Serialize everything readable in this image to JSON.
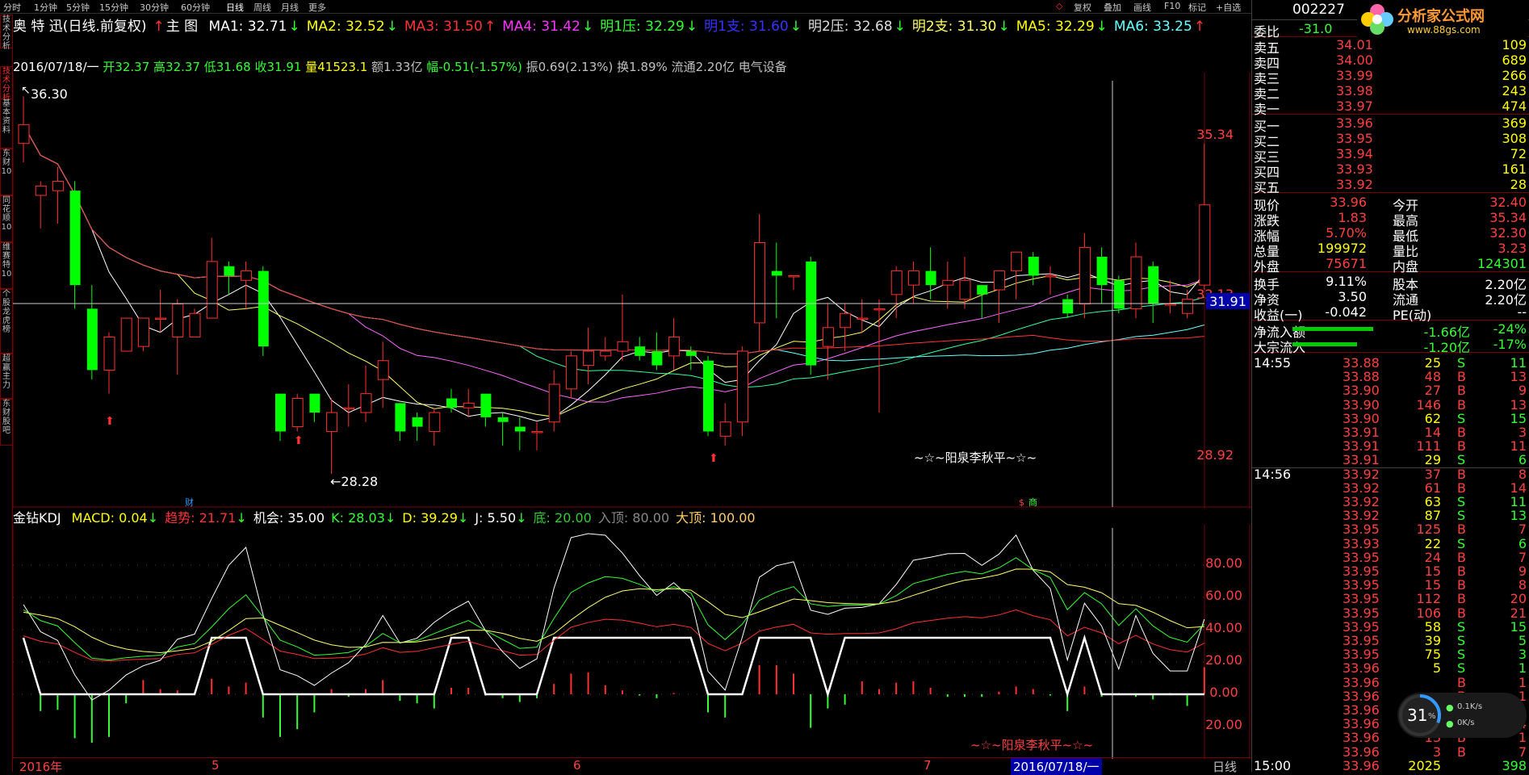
{
  "topbar": {
    "periods": [
      "分时",
      "1分钟",
      "5分钟",
      "15分钟",
      "30分钟",
      "60分钟",
      "日线",
      "周线",
      "月线",
      "更多"
    ],
    "selected": "日线",
    "right_buttons": [
      "复权",
      "叠加",
      "画线",
      "F10",
      "标记",
      "+自选"
    ]
  },
  "sidebar_tabs": [
    "技术分析",
    "基本资料",
    "东财10",
    "同花顺10",
    "维赛特10",
    "个股龙虎榜",
    "超赢主力",
    "东财股吧"
  ],
  "title": {
    "stock": "奥 特 迅(日线.前复权)",
    "chart_label": "主 图",
    "ma": [
      {
        "label": "MA1: 32.71",
        "arrow": "↓",
        "color": "#ffffff"
      },
      {
        "label": "MA2: 32.52",
        "arrow": "↓",
        "color": "#ffff00"
      },
      {
        "label": "MA3: 31.50",
        "arrow": "↑",
        "color": "#ff3333"
      },
      {
        "label": "MA4: 31.42",
        "arrow": "↓",
        "color": "#ff33ff"
      },
      {
        "label": "明1压: 32.29",
        "arrow": "↓",
        "color": "#33ff33"
      },
      {
        "label": "明1支: 31.60",
        "arrow": "↓",
        "color": "#3333ff"
      },
      {
        "label": "明2压: 32.68",
        "arrow": "↓",
        "color": "#dddddd"
      },
      {
        "label": "明2支: 31.30",
        "arrow": "↓",
        "color": "#ffff66"
      },
      {
        "label": "MA5: 32.29",
        "arrow": "↓",
        "color": "#ffff00"
      },
      {
        "label": "MA6: 33.25",
        "arrow": "↑",
        "color": "#66ffff"
      }
    ]
  },
  "info_line": {
    "date": "2016/07/18/一",
    "open": "开32.37",
    "high": "高32.37",
    "low": "低31.68",
    "close": "收31.91",
    "volume": "量41523.1",
    "amount": "额1.33亿",
    "change": "幅-0.51(-1.57%)",
    "amplitude": "振0.69(2.13%)",
    "turnover": "换1.89%",
    "float": "流通2.20亿",
    "industry": "电气设备"
  },
  "main_chart": {
    "labels": {
      "high_mark": "36.30",
      "low_mark": "←28.28",
      "p1": "35.34",
      "p2": "32.13",
      "p3": "28.92",
      "cur": "31.91",
      "watermark": "~☆~阳泉李秋平~☆~",
      "cai": "财",
      "shang": "商"
    }
  },
  "sub_chart": {
    "indicator": "金钻KDJ",
    "items": [
      {
        "label": "MACD: 0.04",
        "arrow": "↓",
        "color": "#ffff00"
      },
      {
        "label": "趋势: 21.71",
        "arrow": "↓",
        "color": "#ff3333"
      },
      {
        "label": "机会: 35.00",
        "arrow": "",
        "color": "#ffffff"
      },
      {
        "label": "K: 28.03",
        "arrow": "↓",
        "color": "#33ff33"
      },
      {
        "label": "D: 39.29",
        "arrow": "↓",
        "color": "#ffff00"
      },
      {
        "label": "J: 5.50",
        "arrow": "↓",
        "color": "#ffffff"
      },
      {
        "label": "底: 20.00",
        "arrow": "",
        "color": "#33cc33"
      },
      {
        "label": "入顶: 80.00",
        "arrow": "",
        "color": "#888888"
      },
      {
        "label": "大顶: 100.00",
        "arrow": "",
        "color": "#ffcc66"
      }
    ],
    "axis": [
      "80.00",
      "60.00",
      "40.00",
      "20.00",
      "0.00",
      "20.00"
    ],
    "watermark": "~☆~阳泉李秋平~☆~"
  },
  "x_axis": {
    "labels": [
      "2016年",
      "5",
      "6",
      "7"
    ],
    "cursor_date": "2016/07/18/一",
    "period": "日线"
  },
  "right_panel": {
    "code": "002227",
    "weibi_label": "委比",
    "weibi_value": "-31.0",
    "asks": [
      {
        "label": "卖五",
        "price": "34.01",
        "vol": "109"
      },
      {
        "label": "卖四",
        "price": "34.00",
        "vol": "689"
      },
      {
        "label": "卖三",
        "price": "33.99",
        "vol": "266"
      },
      {
        "label": "卖二",
        "price": "33.98",
        "vol": "243"
      },
      {
        "label": "卖一",
        "price": "33.97",
        "vol": "474"
      }
    ],
    "bids": [
      {
        "label": "买一",
        "price": "33.96",
        "vol": "369"
      },
      {
        "label": "买二",
        "price": "33.95",
        "vol": "308"
      },
      {
        "label": "买三",
        "price": "33.94",
        "vol": "72"
      },
      {
        "label": "买四",
        "price": "33.93",
        "vol": "161"
      },
      {
        "label": "买五",
        "price": "33.92",
        "vol": "28"
      }
    ],
    "stats": [
      {
        "l1": "现价",
        "v1": "33.96",
        "l2": "今开",
        "v2": "32.40",
        "c1": "#ff4040",
        "c2": "#ff4040"
      },
      {
        "l1": "涨跌",
        "v1": "1.83",
        "l2": "最高",
        "v2": "35.34",
        "c1": "#ff4040",
        "c2": "#ff4040"
      },
      {
        "l1": "涨幅",
        "v1": "5.70%",
        "l2": "最低",
        "v2": "32.30",
        "c1": "#ff4040",
        "c2": "#ff4040"
      },
      {
        "l1": "总量",
        "v1": "199972",
        "l2": "量比",
        "v2": "3.23",
        "c1": "#ffff00",
        "c2": "#ff4040"
      },
      {
        "l1": "外盘",
        "v1": "75671",
        "l2": "内盘",
        "v2": "124301",
        "c1": "#ff4040",
        "c2": "#33ff33"
      }
    ],
    "stats2": [
      {
        "l1": "换手",
        "v1": "9.11%",
        "l2": "股本",
        "v2": "2.20亿"
      },
      {
        "l1": "净资",
        "v1": "3.50",
        "l2": "流通",
        "v2": "2.20亿"
      },
      {
        "l1": "收益(一)",
        "v1": "-0.042",
        "l2": "PE(动)",
        "v2": "--"
      }
    ],
    "flows": [
      {
        "label": "净流入额",
        "value": "-1.66亿",
        "pct": "-24%"
      },
      {
        "label": "大宗流入",
        "value": "-1.20亿",
        "pct": "-17%"
      }
    ],
    "ticks": [
      {
        "time": "14:55",
        "price": "33.88",
        "vol": "25",
        "side": "S",
        "n": "11"
      },
      {
        "time": "",
        "price": "33.88",
        "vol": "48",
        "side": "B",
        "n": "13"
      },
      {
        "time": "",
        "price": "33.90",
        "vol": "27",
        "side": "B",
        "n": "9"
      },
      {
        "time": "",
        "price": "33.90",
        "vol": "146",
        "side": "B",
        "n": "13"
      },
      {
        "time": "",
        "price": "33.90",
        "vol": "62",
        "side": "S",
        "n": "15"
      },
      {
        "time": "",
        "price": "33.91",
        "vol": "14",
        "side": "B",
        "n": "3"
      },
      {
        "time": "",
        "price": "33.91",
        "vol": "111",
        "side": "B",
        "n": "11"
      },
      {
        "time": "",
        "price": "33.91",
        "vol": "29",
        "side": "S",
        "n": "6"
      },
      {
        "time": "14:56",
        "price": "33.92",
        "vol": "37",
        "side": "B",
        "n": "8"
      },
      {
        "time": "",
        "price": "33.92",
        "vol": "61",
        "side": "B",
        "n": "14"
      },
      {
        "time": "",
        "price": "33.92",
        "vol": "63",
        "side": "S",
        "n": "11"
      },
      {
        "time": "",
        "price": "33.92",
        "vol": "87",
        "side": "S",
        "n": "13"
      },
      {
        "time": "",
        "price": "33.95",
        "vol": "125",
        "side": "B",
        "n": "7"
      },
      {
        "time": "",
        "price": "33.93",
        "vol": "22",
        "side": "S",
        "n": "6"
      },
      {
        "time": "",
        "price": "33.95",
        "vol": "24",
        "side": "B",
        "n": "7"
      },
      {
        "time": "",
        "price": "33.95",
        "vol": "15",
        "side": "B",
        "n": "9"
      },
      {
        "time": "",
        "price": "33.95",
        "vol": "15",
        "side": "B",
        "n": "8"
      },
      {
        "time": "",
        "price": "33.95",
        "vol": "112",
        "side": "B",
        "n": "20"
      },
      {
        "time": "",
        "price": "33.95",
        "vol": "106",
        "side": "B",
        "n": "21"
      },
      {
        "time": "",
        "price": "33.95",
        "vol": "58",
        "side": "S",
        "n": "15"
      },
      {
        "time": "",
        "price": "33.95",
        "vol": "39",
        "side": "S",
        "n": "5"
      },
      {
        "time": "",
        "price": "33.95",
        "vol": "75",
        "side": "S",
        "n": "3"
      },
      {
        "time": "",
        "price": "33.96",
        "vol": "5",
        "side": "S",
        "n": "1"
      },
      {
        "time": "",
        "price": "33.96",
        "vol": "",
        "side": "B",
        "n": "1"
      },
      {
        "time": "",
        "price": "33.96",
        "vol": "",
        "side": "B",
        "n": "1"
      },
      {
        "time": "",
        "price": "33.96",
        "vol": "",
        "side": "S",
        "n": "1"
      },
      {
        "time": "",
        "price": "33.96",
        "vol": "16",
        "side": "B",
        "n": "4"
      },
      {
        "time": "",
        "price": "33.96",
        "vol": "13",
        "side": "B",
        "n": "1"
      },
      {
        "time": "",
        "price": "33.96",
        "vol": "3",
        "side": "B",
        "n": "7"
      },
      {
        "time": "15:00",
        "price": "33.96",
        "vol": "2025",
        "side": "",
        "n": "398"
      }
    ],
    "logo": "分析家公式网",
    "logo_url": "www.88gs.com",
    "meter": {
      "pct": "31",
      "unit": "%",
      "up": "0.1K/s",
      "down": "0K/s"
    }
  },
  "candles": [
    {
      "o": 35.3,
      "c": 35.7,
      "h": 36.3,
      "l": 34.9
    },
    {
      "o": 34.2,
      "c": 34.4,
      "h": 34.5,
      "l": 33.5
    },
    {
      "o": 34.3,
      "c": 34.5,
      "h": 34.8,
      "l": 33.6
    },
    {
      "o": 34.3,
      "c": 32.3,
      "h": 34.5,
      "l": 31.8
    },
    {
      "o": 31.8,
      "c": 30.5,
      "h": 32.3,
      "l": 30.3
    },
    {
      "o": 30.5,
      "c": 31.2,
      "h": 31.3,
      "l": 30.0
    },
    {
      "o": 30.9,
      "c": 31.6,
      "h": 31.6,
      "l": 30.9
    },
    {
      "o": 31.0,
      "c": 31.6,
      "h": 31.6,
      "l": 30.9
    },
    {
      "o": 31.6,
      "c": 31.6,
      "h": 32.2,
      "l": 31.3
    },
    {
      "o": 31.2,
      "c": 31.9,
      "h": 32.0,
      "l": 30.4
    },
    {
      "o": 31.2,
      "c": 31.7,
      "h": 31.8,
      "l": 31.2
    },
    {
      "o": 31.6,
      "c": 32.8,
      "h": 33.3,
      "l": 31.6
    },
    {
      "o": 32.7,
      "c": 32.5,
      "h": 32.8,
      "l": 32.1
    },
    {
      "o": 32.4,
      "c": 32.6,
      "h": 32.8,
      "l": 31.8
    },
    {
      "o": 32.6,
      "c": 31.0,
      "h": 32.7,
      "l": 30.8
    },
    {
      "o": 30.0,
      "c": 29.2,
      "h": 30.0,
      "l": 29.0
    },
    {
      "o": 29.3,
      "c": 29.9,
      "h": 30.0,
      "l": 29.2
    },
    {
      "o": 30.0,
      "c": 29.6,
      "h": 30.0,
      "l": 29.4
    },
    {
      "o": 29.2,
      "c": 29.6,
      "h": 29.9,
      "l": 28.3
    },
    {
      "o": 29.7,
      "c": 29.7,
      "h": 30.2,
      "l": 29.3
    },
    {
      "o": 29.6,
      "c": 30.0,
      "h": 30.6,
      "l": 29.4
    },
    {
      "o": 30.3,
      "c": 30.7,
      "h": 31.1,
      "l": 29.7
    },
    {
      "o": 29.8,
      "c": 29.2,
      "h": 29.8,
      "l": 29.0
    },
    {
      "o": 29.5,
      "c": 29.3,
      "h": 29.6,
      "l": 29.0
    },
    {
      "o": 29.2,
      "c": 29.6,
      "h": 29.7,
      "l": 28.9
    },
    {
      "o": 29.9,
      "c": 29.7,
      "h": 30.1,
      "l": 29.6
    },
    {
      "o": 29.7,
      "c": 29.8,
      "h": 30.1,
      "l": 29.5
    },
    {
      "o": 30.0,
      "c": 29.5,
      "h": 30.0,
      "l": 29.3
    },
    {
      "o": 29.5,
      "c": 29.4,
      "h": 29.6,
      "l": 28.9
    },
    {
      "o": 29.3,
      "c": 29.2,
      "h": 29.5,
      "l": 28.8
    },
    {
      "o": 29.2,
      "c": 29.2,
      "h": 29.4,
      "l": 28.8
    },
    {
      "o": 29.4,
      "c": 30.2,
      "h": 30.5,
      "l": 29.2
    },
    {
      "o": 30.1,
      "c": 30.8,
      "h": 30.9,
      "l": 29.9
    },
    {
      "o": 30.6,
      "c": 30.9,
      "h": 31.4,
      "l": 30.2
    },
    {
      "o": 30.8,
      "c": 30.9,
      "h": 31.2,
      "l": 30.7
    },
    {
      "o": 30.9,
      "c": 31.1,
      "h": 32.1,
      "l": 30.7
    },
    {
      "o": 31.0,
      "c": 30.8,
      "h": 31.2,
      "l": 30.7
    },
    {
      "o": 30.9,
      "c": 30.6,
      "h": 31.3,
      "l": 30.5
    },
    {
      "o": 30.8,
      "c": 31.2,
      "h": 31.6,
      "l": 30.5
    },
    {
      "o": 30.9,
      "c": 30.8,
      "h": 31.0,
      "l": 30.5
    },
    {
      "o": 30.7,
      "c": 29.2,
      "h": 30.8,
      "l": 29.1
    },
    {
      "o": 29.1,
      "c": 29.4,
      "h": 29.8,
      "l": 28.9
    },
    {
      "o": 29.4,
      "c": 30.9,
      "h": 31.0,
      "l": 29.1
    },
    {
      "o": 31.5,
      "c": 33.2,
      "h": 33.8,
      "l": 30.9
    },
    {
      "o": 32.6,
      "c": 32.5,
      "h": 33.2,
      "l": 31.6
    },
    {
      "o": 32.5,
      "c": 32.5,
      "h": 32.5,
      "l": 32.2
    },
    {
      "o": 32.8,
      "c": 30.6,
      "h": 32.9,
      "l": 30.4
    },
    {
      "o": 31.0,
      "c": 31.4,
      "h": 31.9,
      "l": 30.3
    },
    {
      "o": 31.4,
      "c": 31.7,
      "h": 31.9,
      "l": 30.9
    },
    {
      "o": 31.6,
      "c": 31.6,
      "h": 32.0,
      "l": 31.3
    },
    {
      "o": 31.8,
      "c": 31.8,
      "h": 32.0,
      "l": 29.6
    },
    {
      "o": 32.1,
      "c": 32.6,
      "h": 32.7,
      "l": 31.6
    },
    {
      "o": 32.3,
      "c": 32.6,
      "h": 32.8,
      "l": 31.9
    },
    {
      "o": 32.6,
      "c": 32.3,
      "h": 33.1,
      "l": 32.0
    },
    {
      "o": 32.3,
      "c": 32.4,
      "h": 32.8,
      "l": 31.8
    },
    {
      "o": 32.0,
      "c": 32.4,
      "h": 32.9,
      "l": 31.8
    },
    {
      "o": 32.3,
      "c": 32.1,
      "h": 32.3,
      "l": 31.6
    },
    {
      "o": 32.2,
      "c": 32.6,
      "h": 32.6,
      "l": 31.5
    },
    {
      "o": 32.6,
      "c": 33.0,
      "h": 33.0,
      "l": 32.0
    },
    {
      "o": 32.9,
      "c": 32.5,
      "h": 33.0,
      "l": 32.3
    },
    {
      "o": 32.5,
      "c": 32.5,
      "h": 32.7,
      "l": 32.1
    },
    {
      "o": 32.0,
      "c": 31.7,
      "h": 32.1,
      "l": 31.6
    },
    {
      "o": 31.9,
      "c": 33.1,
      "h": 33.4,
      "l": 31.6
    },
    {
      "o": 32.9,
      "c": 32.3,
      "h": 33.1,
      "l": 31.9
    },
    {
      "o": 32.4,
      "c": 31.8,
      "h": 32.5,
      "l": 31.7
    },
    {
      "o": 31.8,
      "c": 32.9,
      "h": 33.2,
      "l": 31.6
    },
    {
      "o": 32.7,
      "c": 31.9,
      "h": 32.8,
      "l": 31.5
    },
    {
      "o": 31.9,
      "c": 31.9,
      "h": 32.4,
      "l": 31.7
    },
    {
      "o": 31.7,
      "c": 32.0,
      "h": 32.2,
      "l": 31.6
    },
    {
      "o": 32.3,
      "c": 34.0,
      "h": 35.3,
      "l": 32.2
    }
  ]
}
